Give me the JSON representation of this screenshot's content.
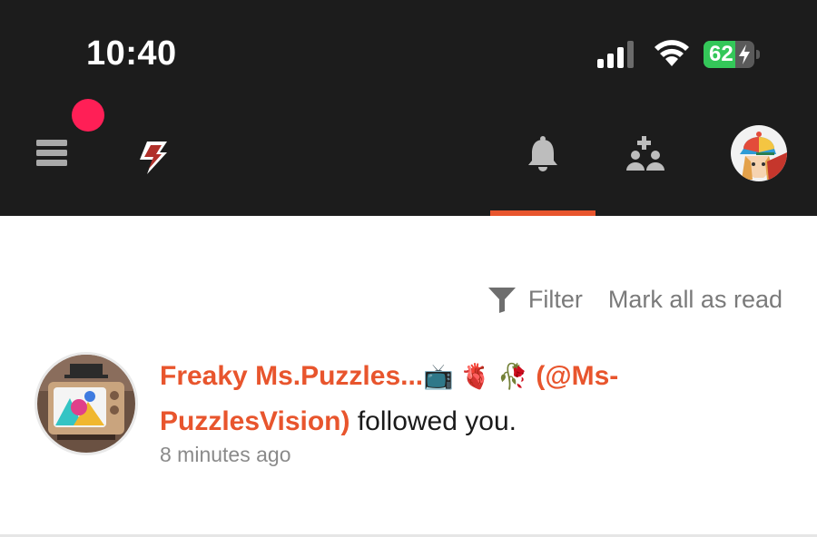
{
  "status_bar": {
    "time": "10:40",
    "signal_icon": "cellular-signal-icon",
    "wifi_icon": "wifi-icon",
    "battery_level": "62",
    "battery_fraction": 0.62,
    "battery_charging_icon": "lightning-bolt-icon"
  },
  "nav": {
    "menu_icon": "hamburger-menu-icon",
    "logo_icon": "lightning-logo-icon",
    "bell_icon": "bell-icon",
    "people_icon": "add-people-icon",
    "active_tab": "notifications",
    "colors": {
      "background": "#1c1c1c",
      "accent": "#e8552d",
      "badge": "#ff1f56"
    }
  },
  "toolbar": {
    "filter_label": "Filter",
    "mark_all_read_label": "Mark all as read"
  },
  "notifications": [
    {
      "user_display": "Freaky Ms.Puzzles...",
      "emojis": "📺 🫀 🥀",
      "handle": "(@Ms-PuzzlesVision)",
      "action": " followed you.",
      "time": "8 minutes ago"
    }
  ]
}
